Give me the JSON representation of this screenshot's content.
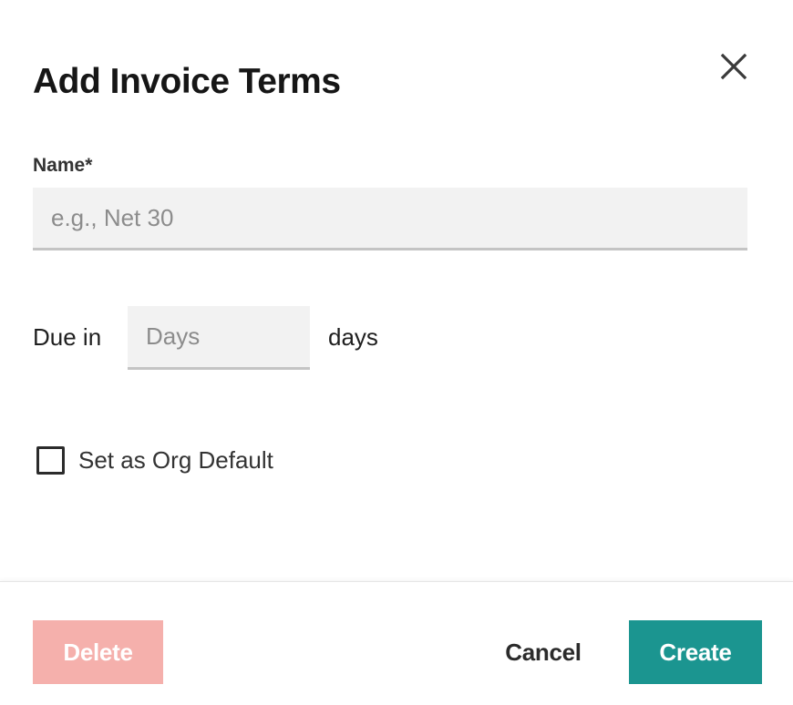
{
  "dialog": {
    "title": "Add Invoice Terms",
    "close_icon": "close-icon"
  },
  "form": {
    "name_label": "Name*",
    "name_value": "",
    "name_placeholder": "e.g., Net 30",
    "due_prefix": "Due in",
    "days_value": "",
    "days_placeholder": "Days",
    "due_suffix": "days",
    "org_default_label": "Set as Org Default",
    "org_default_checked": false
  },
  "footer": {
    "delete_label": "Delete",
    "cancel_label": "Cancel",
    "create_label": "Create"
  },
  "colors": {
    "primary": "#1b9590",
    "danger_disabled": "#f5b0ac",
    "input_bg": "#f2f2f2"
  }
}
